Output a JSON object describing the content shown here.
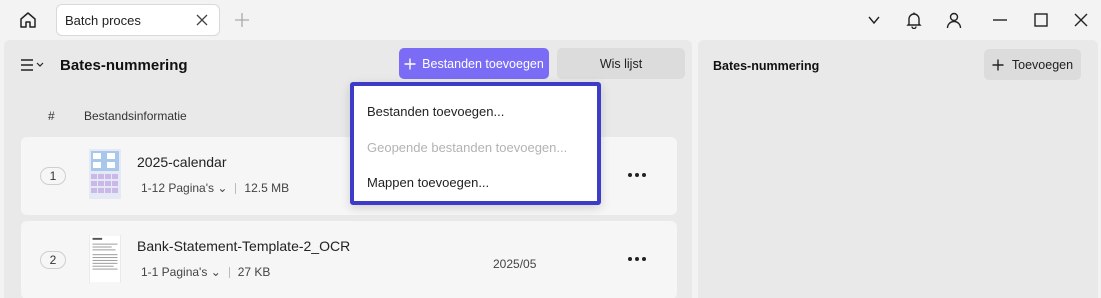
{
  "tab": {
    "title": "Batch proces"
  },
  "left": {
    "title": "Bates-nummering",
    "add_files_label": "Bestanden toevoegen",
    "clear_list_label": "Wis lijst",
    "columns": {
      "index": "#",
      "info": "Bestandsinformatie"
    },
    "files": [
      {
        "index": "1",
        "name": "2025-calendar",
        "pages": "1-12 Pagina's",
        "size": "12.5 MB",
        "date": ""
      },
      {
        "index": "2",
        "name": "Bank-Statement-Template-2_OCR",
        "pages": "1-1 Pagina's",
        "size": "27 KB",
        "date": "2025/05"
      }
    ]
  },
  "right": {
    "title": "Bates-nummering",
    "add_label": "Toevoegen"
  },
  "dropdown": {
    "items": [
      {
        "label": "Bestanden toevoegen...",
        "enabled": true
      },
      {
        "label": "Geopende bestanden toevoegen...",
        "enabled": false
      },
      {
        "label": "Mappen toevoegen...",
        "enabled": true
      }
    ]
  },
  "colors": {
    "accent": "#7b6cf6",
    "dropdown_border": "#3c3cc8",
    "panel_bg": "#e9e9e9"
  },
  "icons": [
    "home-icon",
    "close-icon",
    "plus-icon",
    "chevron-down-icon",
    "bell-icon",
    "user-icon",
    "minimize-icon",
    "maximize-icon",
    "menu-icon",
    "more-icon"
  ]
}
